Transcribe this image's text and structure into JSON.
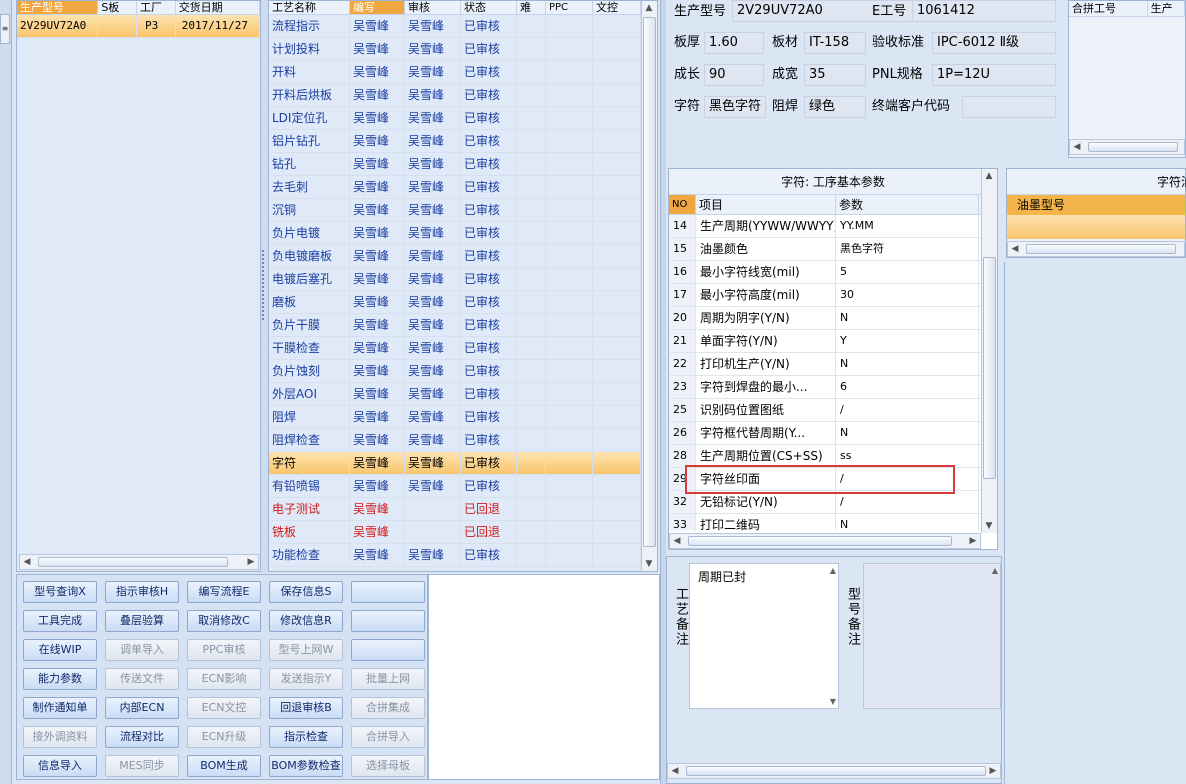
{
  "left_grid": {
    "headers": [
      "生产型号",
      "S板",
      "工厂",
      "交货日期"
    ],
    "rows": [
      {
        "model": "2V29UV72A0",
        "s": "",
        "factory": "P3",
        "date": "2017/11/27"
      }
    ]
  },
  "process_grid": {
    "headers": [
      "工艺名称",
      "编写",
      "审核",
      "状态",
      "难",
      "PPC",
      "文控"
    ],
    "rows": [
      {
        "name": "流程指示",
        "writer": "吴雪峰",
        "auditor": "吴雪峰",
        "status": "已审核"
      },
      {
        "name": "计划投料",
        "writer": "吴雪峰",
        "auditor": "吴雪峰",
        "status": "已审核"
      },
      {
        "name": "开料",
        "writer": "吴雪峰",
        "auditor": "吴雪峰",
        "status": "已审核"
      },
      {
        "name": "开料后烘板",
        "writer": "吴雪峰",
        "auditor": "吴雪峰",
        "status": "已审核"
      },
      {
        "name": "LDI定位孔",
        "writer": "吴雪峰",
        "auditor": "吴雪峰",
        "status": "已审核"
      },
      {
        "name": "铝片钻孔",
        "writer": "吴雪峰",
        "auditor": "吴雪峰",
        "status": "已审核"
      },
      {
        "name": "钻孔",
        "writer": "吴雪峰",
        "auditor": "吴雪峰",
        "status": "已审核"
      },
      {
        "name": "去毛刺",
        "writer": "吴雪峰",
        "auditor": "吴雪峰",
        "status": "已审核"
      },
      {
        "name": "沉铜",
        "writer": "吴雪峰",
        "auditor": "吴雪峰",
        "status": "已审核"
      },
      {
        "name": "负片电镀",
        "writer": "吴雪峰",
        "auditor": "吴雪峰",
        "status": "已审核"
      },
      {
        "name": "负电镀磨板",
        "writer": "吴雪峰",
        "auditor": "吴雪峰",
        "status": "已审核"
      },
      {
        "name": "电镀后塞孔",
        "writer": "吴雪峰",
        "auditor": "吴雪峰",
        "status": "已审核"
      },
      {
        "name": "磨板",
        "writer": "吴雪峰",
        "auditor": "吴雪峰",
        "status": "已审核"
      },
      {
        "name": "负片干膜",
        "writer": "吴雪峰",
        "auditor": "吴雪峰",
        "status": "已审核"
      },
      {
        "name": "干膜检查",
        "writer": "吴雪峰",
        "auditor": "吴雪峰",
        "status": "已审核"
      },
      {
        "name": "负片蚀刻",
        "writer": "吴雪峰",
        "auditor": "吴雪峰",
        "status": "已审核"
      },
      {
        "name": "外层AOI",
        "writer": "吴雪峰",
        "auditor": "吴雪峰",
        "status": "已审核"
      },
      {
        "name": "阻焊",
        "writer": "吴雪峰",
        "auditor": "吴雪峰",
        "status": "已审核"
      },
      {
        "name": "阻焊检查",
        "writer": "吴雪峰",
        "auditor": "吴雪峰",
        "status": "已审核"
      },
      {
        "name": "字符",
        "writer": "吴雪峰",
        "auditor": "吴雪峰",
        "status": "已审核",
        "selected": true
      },
      {
        "name": "有铅喷锡",
        "writer": "吴雪峰",
        "auditor": "吴雪峰",
        "status": "已审核"
      },
      {
        "name": "电子测试",
        "writer": "吴雪峰",
        "auditor": "",
        "status": "已回退",
        "returned": true
      },
      {
        "name": "铣板",
        "writer": "吴雪峰",
        "auditor": "",
        "status": "已回退",
        "returned": true
      },
      {
        "name": "功能检查",
        "writer": "吴雪峰",
        "auditor": "吴雪峰",
        "status": "已审核"
      }
    ]
  },
  "buttons": [
    {
      "label": "型号查询X",
      "enabled": true
    },
    {
      "label": "指示审核H",
      "enabled": true
    },
    {
      "label": "编写流程E",
      "enabled": true
    },
    {
      "label": "保存信息S",
      "enabled": true
    },
    {
      "label": "",
      "enabled": true
    },
    {
      "label": "工具完成",
      "enabled": true
    },
    {
      "label": "叠层验算",
      "enabled": true
    },
    {
      "label": "取消修改C",
      "enabled": true
    },
    {
      "label": "修改信息R",
      "enabled": true
    },
    {
      "label": "",
      "enabled": true
    },
    {
      "label": "在线WIP",
      "enabled": true
    },
    {
      "label": "调单导入",
      "enabled": false
    },
    {
      "label": "PPC审核",
      "enabled": false
    },
    {
      "label": "型号上网W",
      "enabled": false
    },
    {
      "label": "",
      "enabled": true
    },
    {
      "label": "能力参数",
      "enabled": true
    },
    {
      "label": "传送文件",
      "enabled": false
    },
    {
      "label": "ECN影响",
      "enabled": false
    },
    {
      "label": "发送指示Y",
      "enabled": false
    },
    {
      "label": "批量上网",
      "enabled": false
    },
    {
      "label": "制作通知单",
      "enabled": true
    },
    {
      "label": "内部ECN",
      "enabled": true
    },
    {
      "label": "ECN文控",
      "enabled": false
    },
    {
      "label": "回退审核B",
      "enabled": true
    },
    {
      "label": "合拼集成",
      "enabled": false
    },
    {
      "label": "接外调资料",
      "enabled": false
    },
    {
      "label": "流程对比",
      "enabled": true
    },
    {
      "label": "ECN升级",
      "enabled": false
    },
    {
      "label": "指示检查",
      "enabled": true
    },
    {
      "label": "合拼导入",
      "enabled": false
    },
    {
      "label": "信息导入",
      "enabled": true
    },
    {
      "label": "MES同步",
      "enabled": false
    },
    {
      "label": "BOM生成",
      "enabled": true
    },
    {
      "label": "BOM参数检查",
      "enabled": true
    },
    {
      "label": "选择母板",
      "enabled": false
    }
  ],
  "info": {
    "model_label": "生产型号",
    "model_value": "2V29UV72A0",
    "eno_label": "E工号",
    "eno_value": "1061412",
    "thickness_label": "板厚",
    "thickness_value": "1.60",
    "material_label": "板材",
    "material_value": "IT-158",
    "standard_label": "验收标准",
    "standard_value": "IPC-6012 Ⅱ级",
    "length_label": "成长",
    "length_value": "90",
    "width_label": "成宽",
    "width_value": "35",
    "pnl_label": "PNL规格",
    "pnl_value": "1P=12U",
    "char_label": "字符",
    "char_value": "黑色字符",
    "mask_label": "阻焊",
    "mask_value": "绿色",
    "customer_label": "终端客户代码",
    "customer_value": ""
  },
  "merge_panel": {
    "headers": [
      "合拼工号",
      "生产"
    ]
  },
  "params": {
    "title": "字符: 工序基本参数",
    "headers": [
      "NO",
      "项目",
      "参数"
    ],
    "rows": [
      {
        "no": "14",
        "item": "生产周期(YYWW/WWYY)",
        "value": "YY.MM"
      },
      {
        "no": "15",
        "item": "油墨颜色",
        "value": "黑色字符"
      },
      {
        "no": "16",
        "item": "最小字符线宽(mil)",
        "value": "5"
      },
      {
        "no": "17",
        "item": "最小字符高度(mil)",
        "value": "30"
      },
      {
        "no": "20",
        "item": "周期为阴字(Y/N)",
        "value": "N"
      },
      {
        "no": "21",
        "item": "单面字符(Y/N)",
        "value": "Y"
      },
      {
        "no": "22",
        "item": "打印机生产(Y/N)",
        "value": "N"
      },
      {
        "no": "23",
        "item": "字符到焊盘的最小...",
        "value": "6"
      },
      {
        "no": "25",
        "item": "识别码位置图纸",
        "value": "/"
      },
      {
        "no": "26",
        "item": "字符框代替周期(Y...",
        "value": "N"
      },
      {
        "no": "28",
        "item": "生产周期位置(CS+SS)",
        "value": "ss"
      },
      {
        "no": "29",
        "item": "字符丝印面",
        "value": "/"
      },
      {
        "no": "32",
        "item": "无铅标记(Y/N)",
        "value": "/"
      },
      {
        "no": "33",
        "item": "打印二维码",
        "value": "N"
      }
    ]
  },
  "ink_panel": {
    "title": "字符油",
    "header": "油墨型号"
  },
  "notes": {
    "process_label": "工艺备注",
    "process_text": "周期已封",
    "model_label": "型号备注",
    "model_text": ""
  }
}
